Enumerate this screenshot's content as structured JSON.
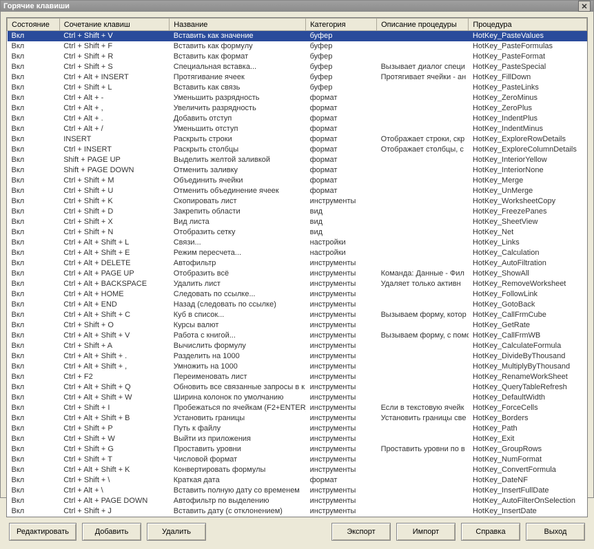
{
  "window": {
    "title": "Горячие клавиши"
  },
  "columns": [
    {
      "key": "state",
      "label": "Состояние"
    },
    {
      "key": "combo",
      "label": "Сочетание клавиш"
    },
    {
      "key": "name",
      "label": "Название"
    },
    {
      "key": "cat",
      "label": "Категория"
    },
    {
      "key": "desc",
      "label": "Описание процедуры"
    },
    {
      "key": "proc",
      "label": "Процедура"
    }
  ],
  "selectedIndex": 0,
  "rows": [
    {
      "state": "Вкл",
      "combo": "Ctrl + Shift + V",
      "name": "Вставить как значение",
      "cat": "буфер",
      "desc": "",
      "proc": "HotKey_PasteValues"
    },
    {
      "state": "Вкл",
      "combo": "Ctrl + Shift + F",
      "name": "Вставить как формулу",
      "cat": "буфер",
      "desc": "",
      "proc": "HotKey_PasteFormulas"
    },
    {
      "state": "Вкл",
      "combo": "Ctrl + Shift + R",
      "name": "Вставить как формат",
      "cat": "буфер",
      "desc": "",
      "proc": "HotKey_PasteFormat"
    },
    {
      "state": "Вкл",
      "combo": "Ctrl + Shift + S",
      "name": "Специальная вставка...",
      "cat": "буфер",
      "desc": "Вызывает диалог специ",
      "proc": "HotKey_PasteSpecial"
    },
    {
      "state": "Вкл",
      "combo": "Ctrl + Alt + INSERT",
      "name": "Протягивание ячеек",
      "cat": "буфер",
      "desc": "Протягивает ячейки - ан",
      "proc": "HotKey_FillDown"
    },
    {
      "state": "Вкл",
      "combo": "Ctrl + Shift + L",
      "name": "Вставить как связь",
      "cat": "буфер",
      "desc": "",
      "proc": "HotKey_PasteLinks"
    },
    {
      "state": "Вкл",
      "combo": "Ctrl + Alt + -",
      "name": "Уменьшить разрядность",
      "cat": "формат",
      "desc": "",
      "proc": "HotKey_ZeroMinus"
    },
    {
      "state": "Вкл",
      "combo": "Ctrl + Alt + ,",
      "name": "Увеличить разрядность",
      "cat": "формат",
      "desc": "",
      "proc": "HotKey_ZeroPlus"
    },
    {
      "state": "Вкл",
      "combo": "Ctrl + Alt + .",
      "name": "Добавить отступ",
      "cat": "формат",
      "desc": "",
      "proc": "HotKey_IndentPlus"
    },
    {
      "state": "Вкл",
      "combo": "Ctrl + Alt + /",
      "name": "Уменьшить отступ",
      "cat": "формат",
      "desc": "",
      "proc": "HotKey_IndentMinus"
    },
    {
      "state": "Вкл",
      "combo": "INSERT",
      "name": "Раскрыть строки",
      "cat": "формат",
      "desc": "Отображает строки, скр",
      "proc": "HotKey_ExploreRowDetails"
    },
    {
      "state": "Вкл",
      "combo": "Ctrl + INSERT",
      "name": "Раскрыть столбцы",
      "cat": "формат",
      "desc": "Отображает столбцы, с",
      "proc": "HotKey_ExploreColumnDetails"
    },
    {
      "state": "Вкл",
      "combo": "Shift + PAGE UP",
      "name": "Выделить желтой заливкой",
      "cat": "формат",
      "desc": "",
      "proc": "HotKey_InteriorYellow"
    },
    {
      "state": "Вкл",
      "combo": "Shift + PAGE DOWN",
      "name": "Отменить заливку",
      "cat": "формат",
      "desc": "",
      "proc": "HotKey_InteriorNone"
    },
    {
      "state": "Вкл",
      "combo": "Ctrl + Shift + M",
      "name": "Объединить ячейки",
      "cat": "формат",
      "desc": "",
      "proc": "HotKey_Merge"
    },
    {
      "state": "Вкл",
      "combo": "Ctrl + Shift + U",
      "name": "Отменить объединение ячеек",
      "cat": "формат",
      "desc": "",
      "proc": "HotKey_UnMerge"
    },
    {
      "state": "Вкл",
      "combo": "Ctrl + Shift + K",
      "name": "Скопировать лист",
      "cat": "инструменты",
      "desc": "",
      "proc": "HotKey_WorksheetCopy"
    },
    {
      "state": "Вкл",
      "combo": "Ctrl + Shift + D",
      "name": "Закрепить области",
      "cat": "вид",
      "desc": "",
      "proc": "HotKey_FreezePanes"
    },
    {
      "state": "Вкл",
      "combo": "Ctrl + Shift + X",
      "name": "Вид листа",
      "cat": "вид",
      "desc": "",
      "proc": "HotKey_SheetView"
    },
    {
      "state": "Вкл",
      "combo": "Ctrl + Shift + N",
      "name": "Отобразить сетку",
      "cat": "вид",
      "desc": "",
      "proc": "HotKey_Net"
    },
    {
      "state": "Вкл",
      "combo": "Ctrl + Alt + Shift + L",
      "name": "Связи...",
      "cat": "настройки",
      "desc": "",
      "proc": "HotKey_Links"
    },
    {
      "state": "Вкл",
      "combo": "Ctrl + Alt + Shift + E",
      "name": "Режим пересчета...",
      "cat": "настройки",
      "desc": "",
      "proc": "HotKey_Calculation"
    },
    {
      "state": "Вкл",
      "combo": "Ctrl + Alt + DELETE",
      "name": "Автофильтр",
      "cat": "инструменты",
      "desc": "",
      "proc": "HotKey_AutoFiltration"
    },
    {
      "state": "Вкл",
      "combo": "Ctrl + Alt + PAGE UP",
      "name": "Отобразить всё",
      "cat": "инструменты",
      "desc": "Команда: Данные - Фил",
      "proc": "HotKey_ShowAll"
    },
    {
      "state": "Вкл",
      "combo": "Ctrl + Alt + BACKSPACE",
      "name": "Удалить лист",
      "cat": "инструменты",
      "desc": "Удаляет только активн",
      "proc": "HotKey_RemoveWorksheet"
    },
    {
      "state": "Вкл",
      "combo": "Ctrl + Alt + HOME",
      "name": "Следовать по ссылке...",
      "cat": "инструменты",
      "desc": "",
      "proc": "HotKey_FollowLink"
    },
    {
      "state": "Вкл",
      "combo": "Ctrl + Alt + END",
      "name": "Назад (следовать по ссылке)",
      "cat": "инструменты",
      "desc": "",
      "proc": "HotKey_GotoBack"
    },
    {
      "state": "Вкл",
      "combo": "Ctrl + Alt + Shift + C",
      "name": "Куб в список...",
      "cat": "инструменты",
      "desc": "Вызываем форму, котор",
      "proc": "HotKey_CallFrmCube"
    },
    {
      "state": "Вкл",
      "combo": "Ctrl + Shift + O",
      "name": "Курсы валют",
      "cat": "инструменты",
      "desc": "",
      "proc": "HotKey_GetRate"
    },
    {
      "state": "Вкл",
      "combo": "Ctrl + Alt + Shift + V",
      "name": "Работа с книгой...",
      "cat": "инструменты",
      "desc": "Вызываем форму, с помо",
      "proc": "HotKey_CallFrmWB"
    },
    {
      "state": "Вкл",
      "combo": "Ctrl + Shift + A",
      "name": "Вычислить формулу",
      "cat": "инструменты",
      "desc": "",
      "proc": "HotKey_CalculateFormula"
    },
    {
      "state": "Вкл",
      "combo": "Ctrl + Alt + Shift + .",
      "name": "Разделить на 1000",
      "cat": "инструменты",
      "desc": "",
      "proc": "HotKey_DivideByThousand"
    },
    {
      "state": "Вкл",
      "combo": "Ctrl + Alt + Shift + ,",
      "name": "Умножить на 1000",
      "cat": "инструменты",
      "desc": "",
      "proc": "HotKey_MultiplyByThousand"
    },
    {
      "state": "Вкл",
      "combo": "Ctrl + F2",
      "name": "Переименовать лист",
      "cat": "инструменты",
      "desc": "",
      "proc": "HotKey_RenameWorkSheet"
    },
    {
      "state": "Вкл",
      "combo": "Ctrl + Alt + Shift + Q",
      "name": "Обновить все связанные запросы в к",
      "cat": "инструменты",
      "desc": "",
      "proc": "HotKey_QueryTableRefresh"
    },
    {
      "state": "Вкл",
      "combo": "Ctrl + Alt + Shift + W",
      "name": "Ширина колонок по умолчанию",
      "cat": "инструменты",
      "desc": "",
      "proc": "HotKey_DefaultWidth"
    },
    {
      "state": "Вкл",
      "combo": "Ctrl + Shift + I",
      "name": "Пробежаться по ячейкам (F2+ENTER)",
      "cat": "инструменты",
      "desc": "Если в текстовую ячейк",
      "proc": "HotKey_ForceCells"
    },
    {
      "state": "Вкл",
      "combo": "Ctrl + Alt + Shift + B",
      "name": "Установить границы",
      "cat": "инструменты",
      "desc": "Установить границы све",
      "proc": "HotKey_Borders"
    },
    {
      "state": "Вкл",
      "combo": "Ctrl + Shift + P",
      "name": "Путь к файлу",
      "cat": "инструменты",
      "desc": "",
      "proc": "HotKey_Path"
    },
    {
      "state": "Вкл",
      "combo": "Ctrl + Shift + W",
      "name": "Выйти из приложения",
      "cat": "инструменты",
      "desc": "",
      "proc": "HotKey_Exit"
    },
    {
      "state": "Вкл",
      "combo": "Ctrl + Shift + G",
      "name": "Проставить уровни",
      "cat": "инструменты",
      "desc": "Проставить уровни по в",
      "proc": "HotKey_GroupRows"
    },
    {
      "state": "Вкл",
      "combo": "Ctrl + Shift + T",
      "name": "Числовой формат",
      "cat": "инструменты",
      "desc": "",
      "proc": "HotKey_NumFormat"
    },
    {
      "state": "Вкл",
      "combo": "Ctrl + Alt + Shift + K",
      "name": "Конвертировать формулы",
      "cat": "инструменты",
      "desc": "",
      "proc": "HotKey_ConvertFormula"
    },
    {
      "state": "Вкл",
      "combo": "Ctrl + Shift + \\",
      "name": "Краткая дата",
      "cat": "формат",
      "desc": "",
      "proc": "HotKey_DateNF"
    },
    {
      "state": "Вкл",
      "combo": "Ctrl + Alt + \\",
      "name": "Вставить полную дату со временем",
      "cat": "инструменты",
      "desc": "",
      "proc": "HotKey_InsertFullDate"
    },
    {
      "state": "Вкл",
      "combo": "Ctrl + Alt + PAGE DOWN",
      "name": "Автофильтр по выделению",
      "cat": "инструменты",
      "desc": "",
      "proc": "HotKey_AutoFilterOnSelection"
    },
    {
      "state": "Вкл",
      "combo": "Ctrl + Shift + J",
      "name": "Вставить дату (с отклонением)",
      "cat": "инструменты",
      "desc": "",
      "proc": "HotKey_InsertDate"
    }
  ],
  "buttons": {
    "edit": "Редактировать",
    "add": "Добавить",
    "delete": "Удалить",
    "export": "Экспорт",
    "import": "Импорт",
    "help": "Справка",
    "exit": "Выход"
  }
}
